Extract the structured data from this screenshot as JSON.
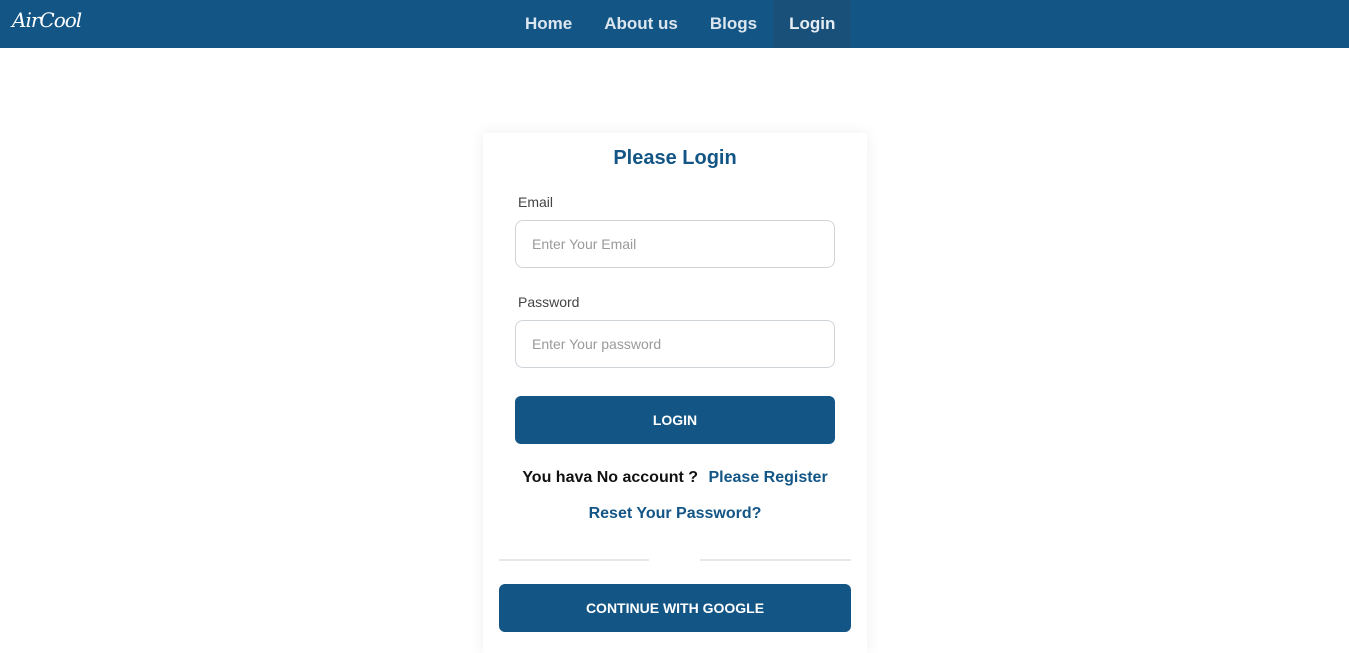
{
  "brand": {
    "logo_text": "AirCool"
  },
  "nav": {
    "items": [
      {
        "label": "Home"
      },
      {
        "label": "About us"
      },
      {
        "label": "Blogs"
      },
      {
        "label": "Login"
      }
    ],
    "active": "Login"
  },
  "login": {
    "title": "Please Login",
    "email_label": "Email",
    "email_placeholder": "Enter Your Email",
    "email_value": "",
    "password_label": "Password",
    "password_placeholder": "Enter Your password",
    "password_value": "",
    "login_button": "LOGIN",
    "no_account_text": "You hava No account ?",
    "register_link": "Please Register",
    "reset_link": "Reset Your Password?",
    "google_button": "CONTINUE WITH GOOGLE"
  },
  "colors": {
    "primary": "#135686",
    "nav_active": "#19507a",
    "background": "#ffffff"
  }
}
